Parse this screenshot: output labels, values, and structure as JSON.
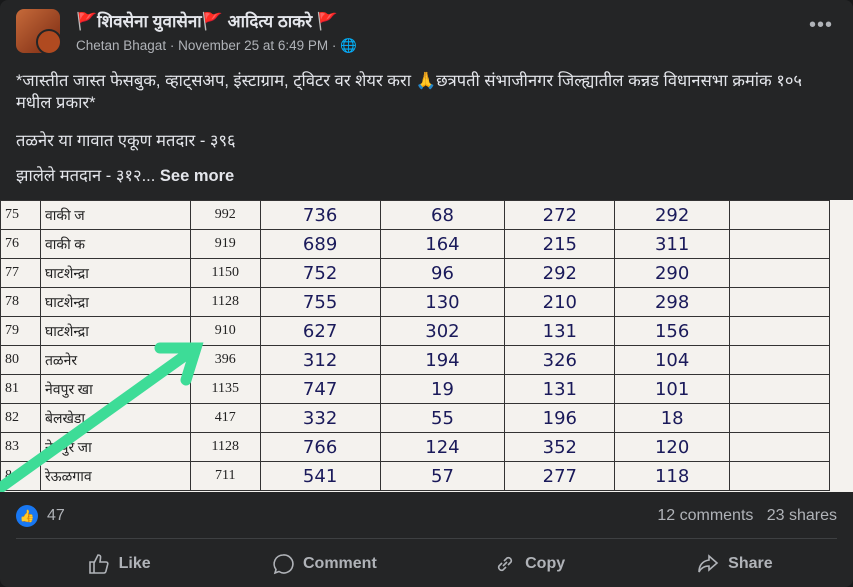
{
  "post": {
    "title": "🚩शिवसेना युवासेना🚩 आदित्य ठाकरे 🚩",
    "author": "Chetan Bhagat",
    "time": "November 25 at 6:49 PM",
    "privacy_icon": "globe-icon",
    "text_line1": "*जास्तीत जास्त फेसबुक, व्हाट्सअप, इंस्टाग्राम, ट्विटर वर शेयर करा 🙏छत्रपती संभाजीनगर जिल्ह्यातील कन्नड विधानसभा क्रमांक १०५ मधील प्रकार*",
    "text_line2": "तळनेर या गावात एकूण मतदार - ३९६",
    "text_line3": "झालेले मतदान - ३१२...",
    "see_more": "See more"
  },
  "photo": {
    "rows": [
      [
        "75",
        "वाकी ज",
        "992",
        "736",
        "68",
        "272",
        "292"
      ],
      [
        "76",
        "वाकी क",
        "919",
        "689",
        "164",
        "215",
        "311"
      ],
      [
        "77",
        "घाटशेन्द्रा",
        "1150",
        "752",
        "96",
        "292",
        "290"
      ],
      [
        "78",
        "घाटशेन्द्रा",
        "1128",
        "755",
        "130",
        "210",
        "298"
      ],
      [
        "79",
        "घाटशेन्द्रा",
        "910",
        "627",
        "302",
        "131",
        "156"
      ],
      [
        "80",
        "तळनेर",
        "396",
        "312",
        "194",
        "326",
        "104"
      ],
      [
        "81",
        "नेवपुर खा",
        "1135",
        "747",
        "19",
        "131",
        "101"
      ],
      [
        "82",
        "बेलखेडा",
        "417",
        "332",
        "55",
        "196",
        "18"
      ],
      [
        "83",
        "नेवपुर जा",
        "1128",
        "766",
        "124",
        "352",
        "120"
      ],
      [
        "84",
        "रेऊळगाव",
        "711",
        "541",
        "57",
        "277",
        "118"
      ]
    ],
    "arrow_color": "#3ddc97"
  },
  "stats": {
    "reactions": "47",
    "comments": "12 comments",
    "shares": "23 shares"
  },
  "actions": {
    "like": "Like",
    "comment": "Comment",
    "copy": "Copy",
    "share": "Share"
  },
  "colors": {
    "background": "#242526",
    "text": "#e4e6eb",
    "secondary": "#b0b3b8",
    "like_blue": "#1877f2"
  }
}
